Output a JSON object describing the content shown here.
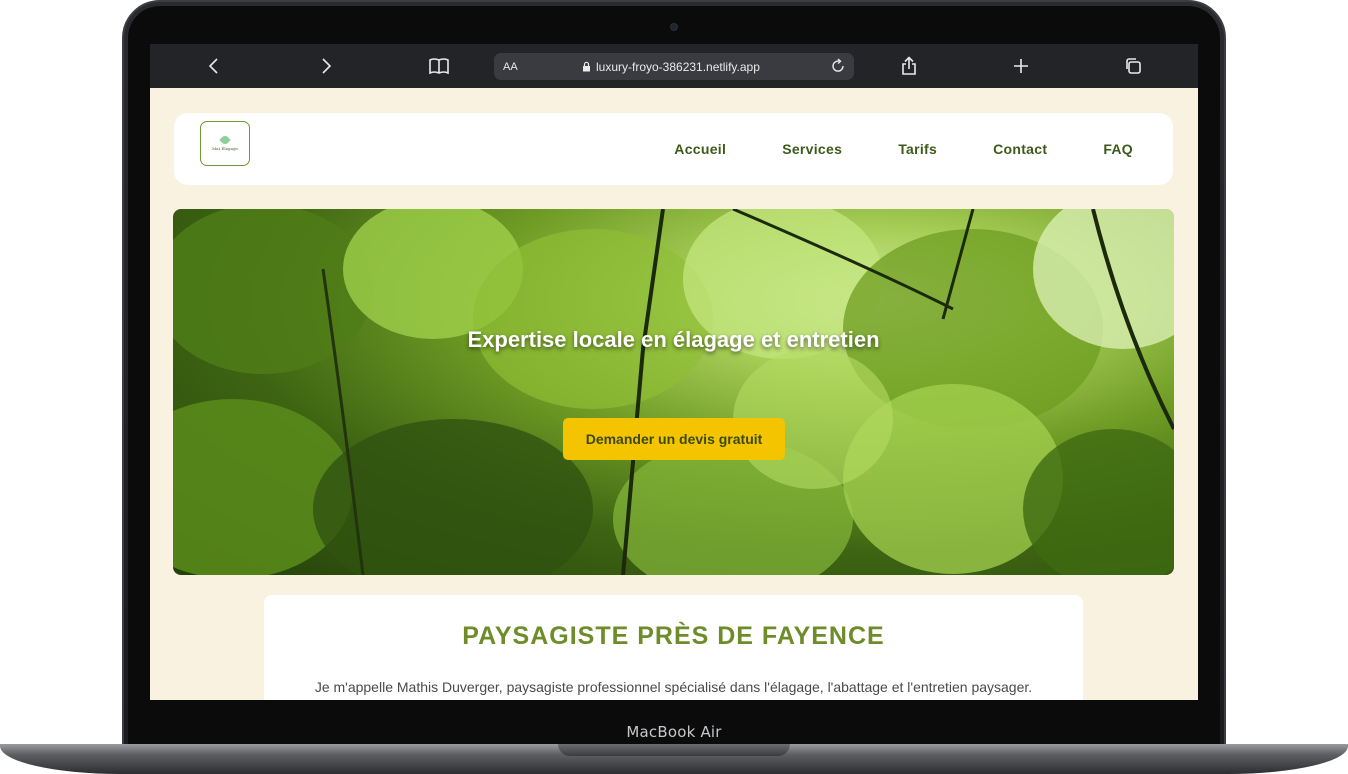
{
  "device": {
    "label": "MacBook Air"
  },
  "browser": {
    "text_size_label": "AA",
    "url": "luxury-froyo-386231.netlify.app",
    "icons": [
      "chevron-left-icon",
      "chevron-right-icon",
      "book-icon",
      "lock-icon",
      "reload-icon",
      "share-icon",
      "plus-icon",
      "tabs-icon"
    ]
  },
  "site": {
    "logo_text": "Mat Élagage",
    "nav": [
      {
        "label": "Accueil"
      },
      {
        "label": "Services"
      },
      {
        "label": "Tarifs"
      },
      {
        "label": "Contact"
      },
      {
        "label": "FAQ"
      }
    ],
    "hero": {
      "title": "Expertise locale en élagage et entretien",
      "cta_label": "Demander un devis gratuit"
    },
    "intro": {
      "heading": "PAYSAGISTE PRÈS DE FAYENCE",
      "text": "Je m'appelle Mathis Duverger, paysagiste professionnel spécialisé dans l'élagage, l'abattage et l'entretien paysager."
    },
    "colors": {
      "background": "#faf2e1",
      "nav_text": "#3e5a1a",
      "accent_yellow": "#f4c400",
      "heading_green": "#6f8c2a"
    }
  }
}
